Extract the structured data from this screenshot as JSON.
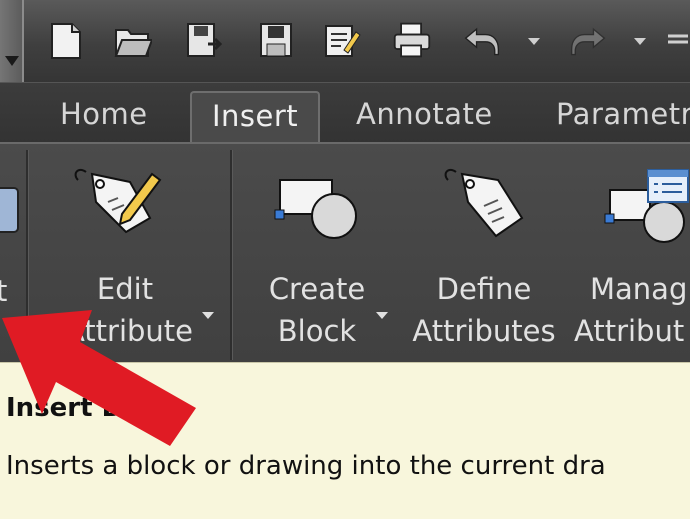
{
  "tabs": [
    {
      "label": "Home"
    },
    {
      "label": "Insert"
    },
    {
      "label": "Annotate"
    },
    {
      "label": "Parametr"
    }
  ],
  "ribbon": {
    "insert_partial": "t",
    "edit_attribute": {
      "line1": "Edit",
      "line2": "Attribute"
    },
    "create_block": {
      "line1": "Create",
      "line2": "Block"
    },
    "define_attributes": {
      "line1": "Define",
      "line2": "Attributes"
    },
    "manage_attributes": {
      "line1": "Manag",
      "line2": "Attribut"
    }
  },
  "tooltip": {
    "title": "Insert Block",
    "description": "Inserts a block or drawing into the current dra"
  },
  "quick_access": [
    "new-icon",
    "open-icon",
    "save-as-icon",
    "save-icon",
    "properties-icon",
    "print-icon",
    "undo-icon",
    "redo-icon",
    "customize-icon"
  ],
  "colors": {
    "accent_arrow": "#e01b24",
    "tooltip_bg": "#f8f6dc",
    "ribbon_bg": "#454545"
  }
}
